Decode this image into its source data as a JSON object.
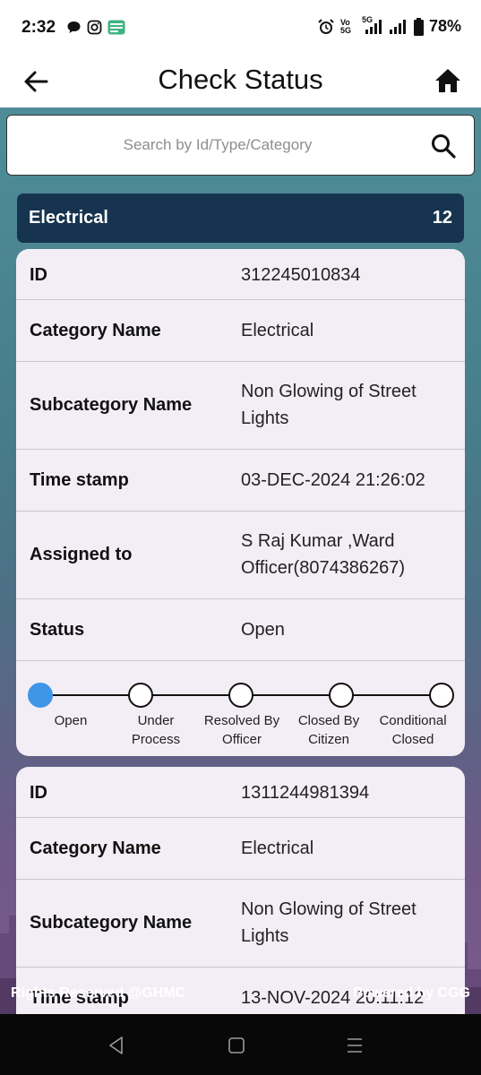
{
  "status_bar": {
    "time": "2:32",
    "left_icons": [
      "chat-bubble-icon",
      "instagram-icon",
      "app-badge-icon"
    ],
    "right_icons": [
      "alarm-icon",
      "volte-icon",
      "signal-5g-icon",
      "signal-icon",
      "battery-icon"
    ],
    "volte_label": "Vo 5G",
    "network_label": "5G",
    "battery": "78%"
  },
  "app_bar": {
    "title": "Check Status",
    "back_icon": "arrow-left-icon",
    "home_icon": "home-icon"
  },
  "search": {
    "placeholder": "Search by Id/Type/Category",
    "value": "",
    "icon": "search-icon"
  },
  "category": {
    "name": "Electrical",
    "count": "12",
    "color": "#16344f"
  },
  "complaints": [
    {
      "rows": [
        {
          "label": "ID",
          "value": "312245010834"
        },
        {
          "label": "Category Name",
          "value": "Electrical"
        },
        {
          "label": "Subcategory Name",
          "value": "Non Glowing of Street Lights"
        },
        {
          "label": "Time stamp",
          "value": "03-DEC-2024 21:26:02"
        },
        {
          "label": "Assigned to",
          "value": "S Raj Kumar ,Ward Officer(8074386267)"
        },
        {
          "label": "Status",
          "value": "Open"
        }
      ],
      "timeline": {
        "active_index": 0,
        "steps": [
          "Open",
          "Under Process",
          "Resolved By Officer",
          "Closed By Citizen",
          "Conditional Closed"
        ]
      }
    },
    {
      "rows": [
        {
          "label": "ID",
          "value": "1311244981394"
        },
        {
          "label": "Category Name",
          "value": "Electrical"
        },
        {
          "label": "Subcategory Name",
          "value": "Non Glowing of Street Lights"
        },
        {
          "label": "Time stamp",
          "value": "13-NOV-2024 20:11:12"
        }
      ]
    }
  ],
  "footer": {
    "left": "Rights Reserved @GHMC",
    "right": "Powered by CGG"
  },
  "nav_bar": {
    "back_icon": "nav-back-icon",
    "home_icon": "nav-home-icon",
    "recents_icon": "nav-recents-icon"
  },
  "colors": {
    "accent_active": "#3f96e8",
    "card_bg": "#f3eef6"
  }
}
